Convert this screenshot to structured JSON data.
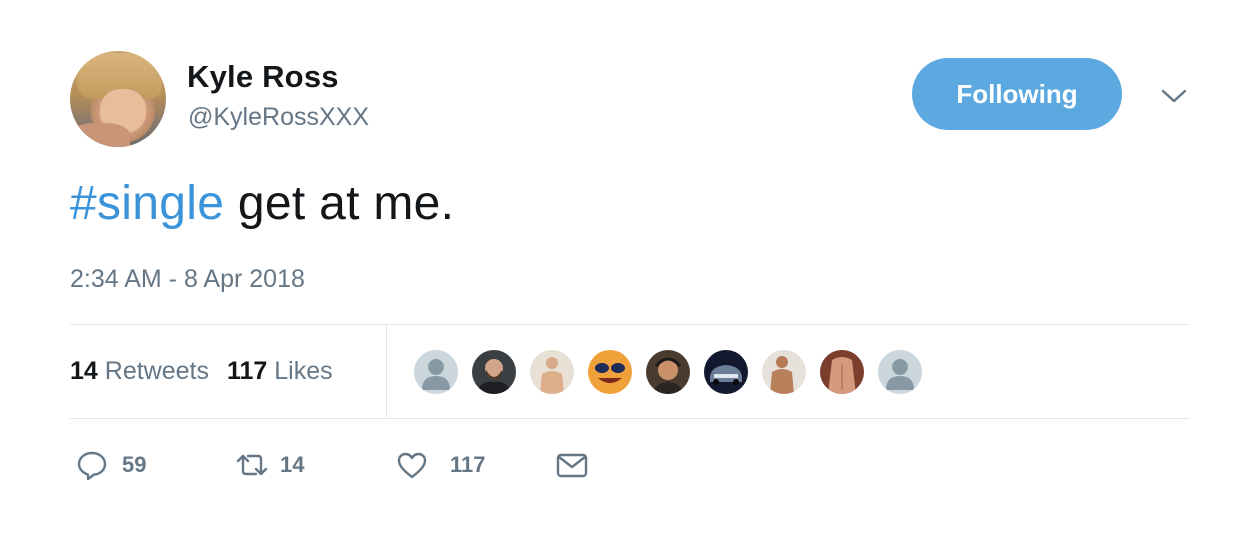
{
  "user": {
    "name": "Kyle Ross",
    "handle": "@KyleRossXXX"
  },
  "follow_button": {
    "label": "Following"
  },
  "tweet": {
    "hashtag": "#single",
    "text": " get at me.",
    "timestamp": "2:34 AM - 8 Apr 2018"
  },
  "stats": {
    "retweets_count": "14",
    "retweets_label": "Retweets",
    "likes_count": "117",
    "likes_label": "Likes"
  },
  "actions": {
    "reply_count": "59",
    "retweet_count": "14",
    "like_count": "117"
  },
  "colors": {
    "accent": "#5ca8e0",
    "link": "#3b94d9",
    "secondary_text": "#657786",
    "divider": "#e1e8ed"
  },
  "icons": [
    "reply-icon",
    "retweet-icon",
    "like-icon",
    "direct-message-icon",
    "chevron-down-icon"
  ]
}
